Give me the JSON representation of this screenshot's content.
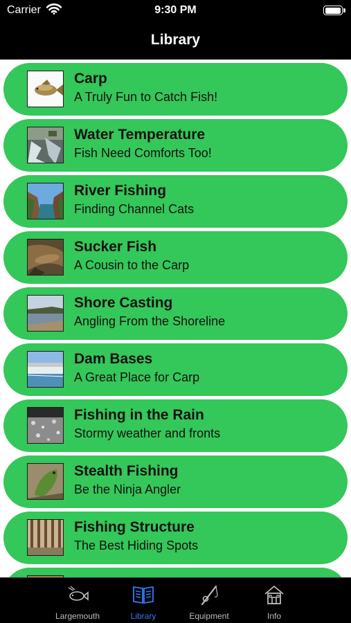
{
  "status_bar": {
    "carrier": "Carrier",
    "time": "9:30 PM"
  },
  "nav": {
    "title": "Library"
  },
  "items": [
    {
      "title": "Carp",
      "subtitle": "A Truly Fun to Catch Fish!"
    },
    {
      "title": "Water Temperature",
      "subtitle": "Fish Need Comforts Too!"
    },
    {
      "title": "River Fishing",
      "subtitle": "Finding Channel Cats"
    },
    {
      "title": "Sucker Fish",
      "subtitle": "A Cousin to the Carp"
    },
    {
      "title": "Shore Casting",
      "subtitle": "Angling From the Shoreline"
    },
    {
      "title": "Dam Bases",
      "subtitle": "A Great Place for Carp"
    },
    {
      "title": "Fishing in the Rain",
      "subtitle": "Stormy weather and fronts"
    },
    {
      "title": "Stealth Fishing",
      "subtitle": "Be the Ninja Angler"
    },
    {
      "title": "Fishing Structure",
      "subtitle": "The Best Hiding Spots"
    }
  ],
  "tabs": [
    {
      "label": "Largemouth",
      "icon": "fish-icon"
    },
    {
      "label": "Library",
      "icon": "book-icon",
      "selected": true
    },
    {
      "label": "Equipment",
      "icon": "fishing-rod-icon"
    },
    {
      "label": "Info",
      "icon": "house-icon"
    }
  ],
  "colors": {
    "row": "#34c759",
    "tab_active": "#2f7cf6",
    "bars": "#000000"
  }
}
